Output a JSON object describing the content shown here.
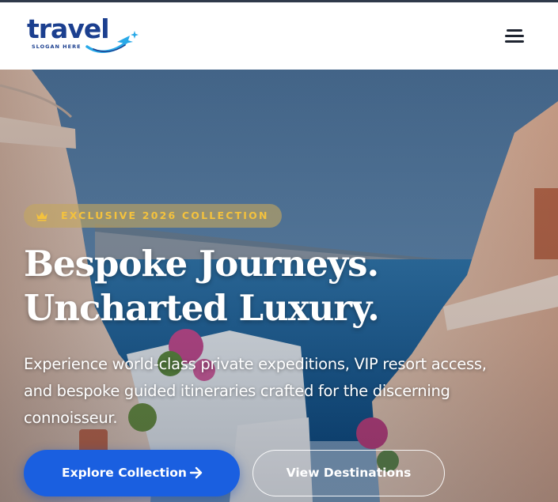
{
  "header": {
    "logo_word": "travel",
    "logo_slogan": "SLOGAN HERE",
    "menu_icon": "hamburger-menu-icon"
  },
  "hero": {
    "badge_icon": "crown-icon",
    "badge_text": "EXCLUSIVE 2026 COLLECTION",
    "headline_line1": "Bespoke Journeys.",
    "headline_line2": "Uncharted Luxury.",
    "description": "Experience world-class private expeditions, VIP resort access, and bespoke guided itineraries crafted for the discerning connoisseur.",
    "primary_cta": "Explore Collection",
    "primary_cta_icon": "arrow-right-icon",
    "secondary_cta": "View Destinations"
  },
  "colors": {
    "brand_blue": "#1b3f8f",
    "primary_button": "#1a5fe0",
    "badge_text": "#f4c23d",
    "badge_bg": "#c4a65f"
  }
}
